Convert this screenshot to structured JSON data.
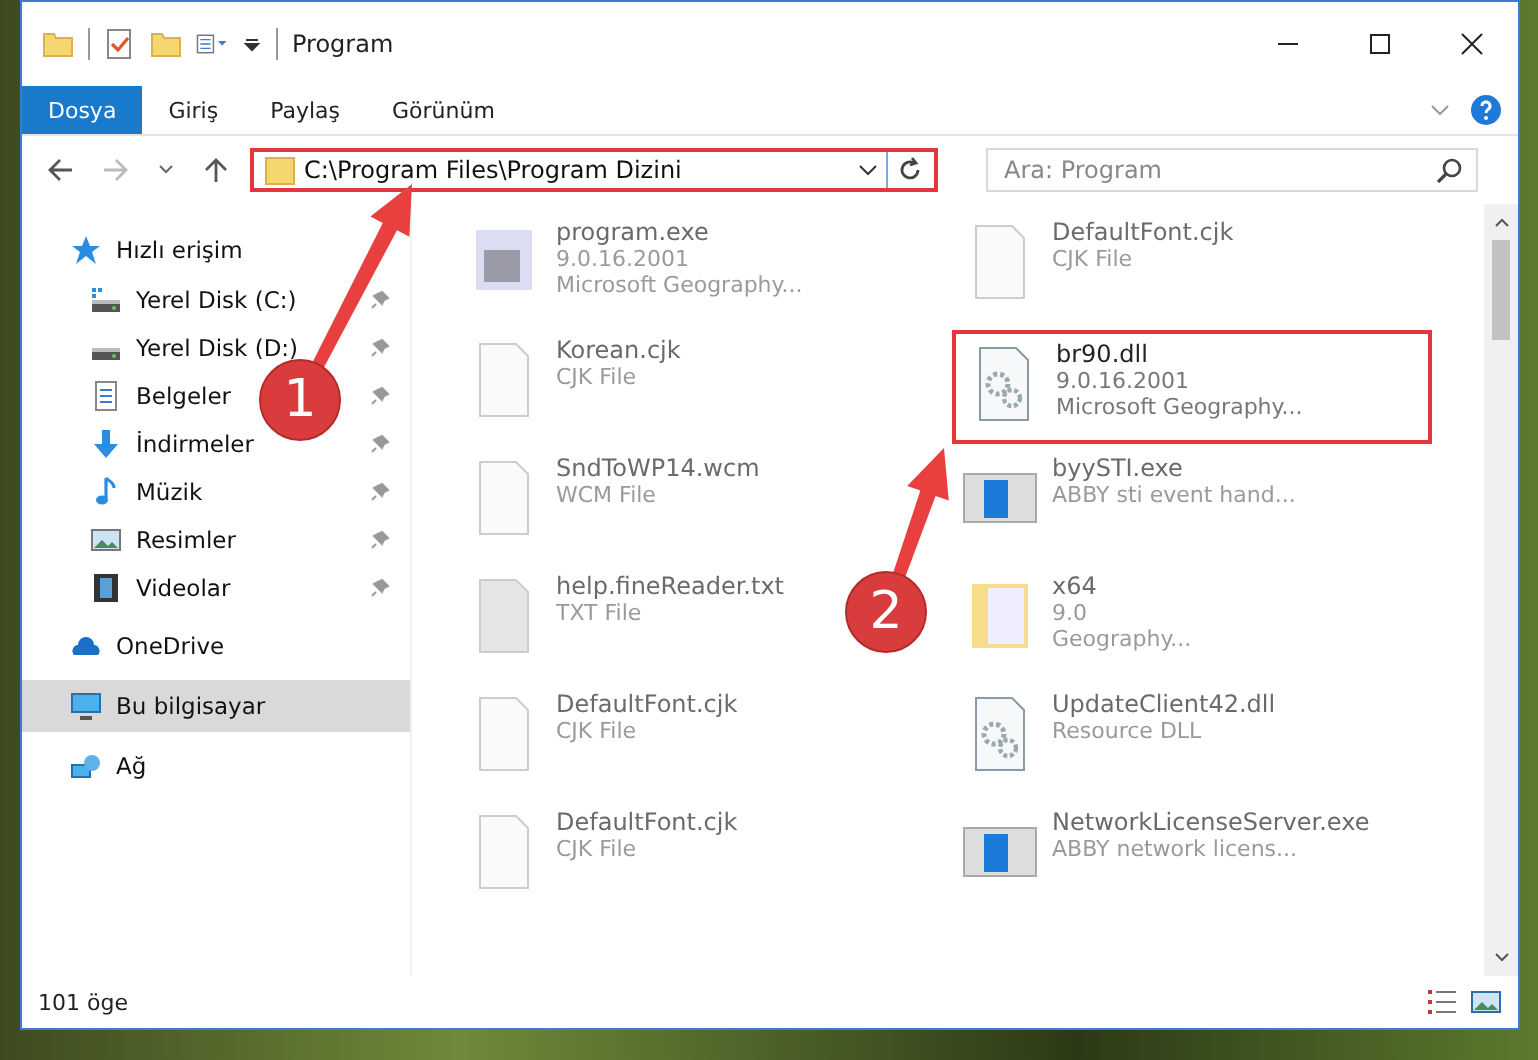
{
  "window": {
    "title": "Program"
  },
  "ribbon_tabs": [
    {
      "label": "Dosya",
      "selected": true
    },
    {
      "label": "Giriş",
      "selected": false
    },
    {
      "label": "Paylaş",
      "selected": false
    },
    {
      "label": "Görünüm",
      "selected": false
    }
  ],
  "address_bar": {
    "path": "C:\\Program Files\\Program Dizini",
    "highlighted": true
  },
  "search": {
    "placeholder": "Ara: Program"
  },
  "sidebar": {
    "items": [
      {
        "label": "Hızlı erişim",
        "kind": "group",
        "pinned": false,
        "selected": false
      },
      {
        "label": "Yerel Disk (C:)",
        "kind": "link",
        "pinned": true,
        "selected": false
      },
      {
        "label": "Yerel Disk (D:)",
        "kind": "link",
        "pinned": true,
        "selected": false
      },
      {
        "label": "Belgeler",
        "kind": "link",
        "pinned": true,
        "selected": false
      },
      {
        "label": "İndirmeler",
        "kind": "link",
        "pinned": true,
        "selected": false
      },
      {
        "label": "Müzik",
        "kind": "link",
        "pinned": true,
        "selected": false
      },
      {
        "label": "Resimler",
        "kind": "link",
        "pinned": true,
        "selected": false
      },
      {
        "label": "Videolar",
        "kind": "link",
        "pinned": true,
        "selected": false
      },
      {
        "label": "OneDrive",
        "kind": "group",
        "pinned": false,
        "selected": false
      },
      {
        "label": "Bu bilgisayar",
        "kind": "group",
        "pinned": false,
        "selected": true
      },
      {
        "label": "Ağ",
        "kind": "group",
        "pinned": false,
        "selected": false
      }
    ]
  },
  "files": [
    {
      "name": "program.exe",
      "lines": [
        "9.0.16.2001",
        "Microsoft Geography..."
      ],
      "highlighted": false
    },
    {
      "name": "DefaultFont.cjk",
      "lines": [
        "CJK File"
      ],
      "highlighted": false
    },
    {
      "name": "Korean.cjk",
      "lines": [
        "CJK File"
      ],
      "highlighted": false
    },
    {
      "name": "br90.dll",
      "lines": [
        "9.0.16.2001",
        "Microsoft Geography..."
      ],
      "highlighted": true
    },
    {
      "name": "SndToWP14.wcm",
      "lines": [
        "WCM File"
      ],
      "highlighted": false
    },
    {
      "name": "byySTI.exe",
      "lines": [
        "ABBY sti event hand..."
      ],
      "highlighted": false
    },
    {
      "name": "help.fineReader.txt",
      "lines": [
        "TXT File"
      ],
      "highlighted": false
    },
    {
      "name": "x64",
      "lines": [
        "9.0",
        "Geography..."
      ],
      "highlighted": false
    },
    {
      "name": "DefaultFont.cjk",
      "lines": [
        "CJK File"
      ],
      "highlighted": false
    },
    {
      "name": "UpdateClient42.dll",
      "lines": [
        "Resource DLL"
      ],
      "highlighted": false
    },
    {
      "name": "DefaultFont.cjk",
      "lines": [
        "CJK File"
      ],
      "highlighted": false
    },
    {
      "name": "NetworkLicenseServer.exe",
      "lines": [
        "ABBY network licens..."
      ],
      "highlighted": false
    }
  ],
  "status_bar": {
    "count": "101 öge"
  },
  "annotations": [
    {
      "label": "1"
    },
    {
      "label": "2"
    }
  ]
}
